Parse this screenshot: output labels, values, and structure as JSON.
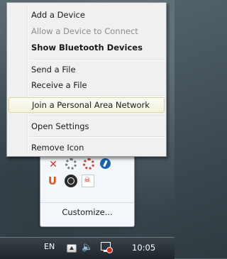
{
  "context_menu": {
    "items": [
      {
        "label": "Add a Device",
        "state": "normal"
      },
      {
        "label": "Allow a Device to Connect",
        "state": "disabled"
      },
      {
        "label": "Show Bluetooth Devices",
        "state": "bold"
      },
      {
        "label": "Send a File",
        "state": "normal"
      },
      {
        "label": "Receive a File",
        "state": "normal"
      },
      {
        "label": "Join a Personal Area Network",
        "state": "hover"
      },
      {
        "label": "Open Settings",
        "state": "normal"
      },
      {
        "label": "Remove Icon",
        "state": "normal"
      }
    ]
  },
  "overflow_panel": {
    "icons": [
      "x-icon",
      "gear-icon",
      "gear-icon",
      "blue-app-icon",
      "u-app-icon",
      "steam-icon",
      "pdf-icon"
    ],
    "customize_label": "Customize..."
  },
  "taskbar": {
    "language": "EN",
    "clock": "10:05",
    "icons": [
      "show-hidden-icons-arrow",
      "volume-icon",
      "network-icon"
    ]
  },
  "colors": {
    "menu_bg": "#f0f0f0",
    "hover_bg": "#f4f3dc",
    "disabled_text": "#8d8d8d",
    "taskbar_bg": "#1e262c"
  }
}
